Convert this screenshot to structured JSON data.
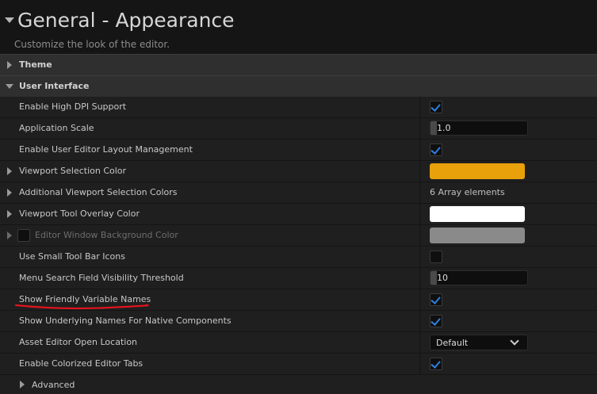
{
  "header": {
    "title": "General - Appearance",
    "subtitle": "Customize the look of the editor."
  },
  "sections": {
    "theme": "Theme",
    "user_interface": "User Interface"
  },
  "rows": [
    {
      "label": "Enable High DPI Support",
      "control": "checkbox",
      "checked": true
    },
    {
      "label": "Application Scale",
      "control": "number",
      "value": "1.0"
    },
    {
      "label": "Enable User Editor Layout Management",
      "control": "checkbox",
      "checked": true
    },
    {
      "label": "Viewport Selection Color",
      "control": "color",
      "color": "#e8a10b"
    },
    {
      "label": "Additional Viewport Selection Colors",
      "control": "array",
      "value": "6 Array elements"
    },
    {
      "label": "Viewport Tool Overlay Color",
      "control": "color",
      "color": "#ffffff"
    },
    {
      "label": "Editor Window Background Color",
      "control": "color",
      "color": "#8a8a8a",
      "disabled": true
    },
    {
      "label": "Use Small Tool Bar Icons",
      "control": "checkbox",
      "checked": false
    },
    {
      "label": "Menu Search Field Visibility Threshold",
      "control": "number",
      "value": "10"
    },
    {
      "label": "Show Friendly Variable Names",
      "control": "checkbox",
      "checked": true,
      "annotated": true
    },
    {
      "label": "Show Underlying Names For Native Components",
      "control": "checkbox",
      "checked": true
    },
    {
      "label": "Asset Editor Open Location",
      "control": "dropdown",
      "value": "Default"
    },
    {
      "label": "Enable Colorized Editor Tabs",
      "control": "checkbox",
      "checked": true
    }
  ],
  "advanced": "Advanced",
  "colors": {
    "accent_check": "#2f7fe0",
    "annotation_red": "#e0141e"
  }
}
